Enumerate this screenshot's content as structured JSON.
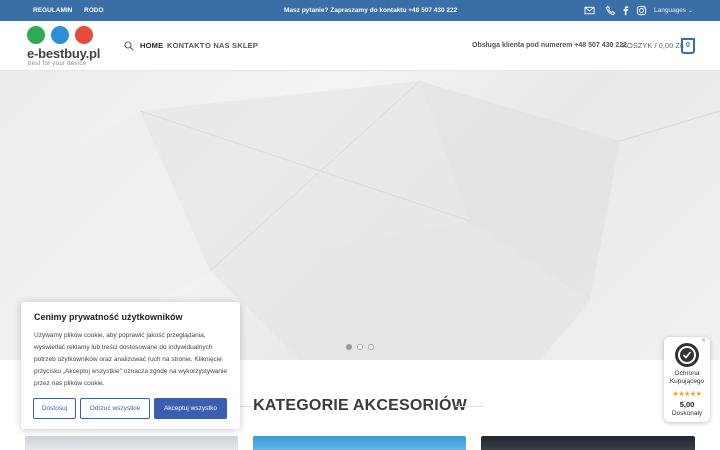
{
  "topbar": {
    "links": [
      "REGULAMIN",
      "RODO"
    ],
    "contact_text": "Masz pytanie? Zapraszamy do kontaktu +48 507 430 222",
    "icons": [
      "mail-icon",
      "phone-icon",
      "facebook-icon",
      "instagram-icon"
    ],
    "language_label": "Languages"
  },
  "header": {
    "logo_brand": "e-bestbuy.pl",
    "logo_tagline": "best for your device",
    "logo_colors": [
      "#2eaa55",
      "#2f8fd6",
      "#e54b3c"
    ],
    "nav": [
      "HOME",
      "KONTAKT",
      "O NAS",
      "SKLEP"
    ],
    "support_text": "Obsługa klienta pod numerem +48 507 430 222",
    "cart_label": "KOSZYK / 0,00 ZŁ",
    "cart_count": "0"
  },
  "hero": {
    "slides_count": 3,
    "active_slide": 1
  },
  "section": {
    "title": "KATEGORIE AKCESORIÓW"
  },
  "cookie": {
    "title": "Cenimy prywatność użytkowników",
    "body": "Używamy plików cookie, aby poprawić jakość przeglądania, wyświetlać reklamy lub treści dostosowane do indywidualnych potrzeb użytkowników oraz analizować ruch na stronie. Kliknięcie przycisku „Akceptuj wszystkie\" oznacza zgodę na wykorzystywanie przez nas plików cookie.",
    "btn_customize": "Dostosuj",
    "btn_reject": "Odrzuć wszystkie",
    "btn_accept": "Akceptuj wszystko"
  },
  "trust": {
    "label": "Ochrona Kupującego",
    "stars": "★★★★★",
    "score": "5,00",
    "rating": "Doskonały"
  },
  "colors": {
    "primary": "#3a6ea6",
    "button_blue": "#3a5fb0",
    "star": "#f0a020"
  }
}
